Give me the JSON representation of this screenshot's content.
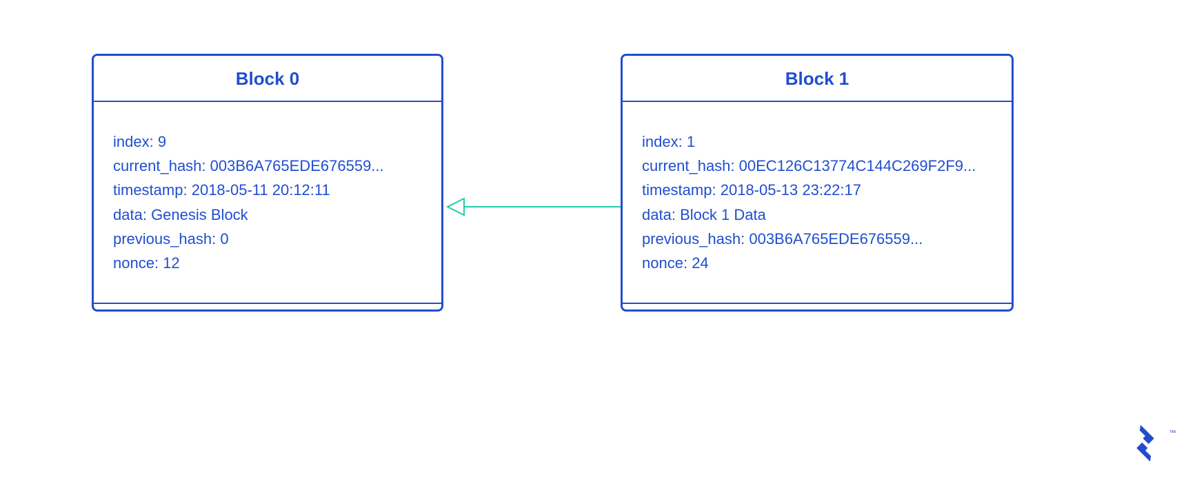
{
  "blocks": [
    {
      "title": "Block 0",
      "fields": [
        {
          "key": "index",
          "value": "9"
        },
        {
          "key": "current_hash",
          "value": "003B6A765EDE676559..."
        },
        {
          "key": "timestamp",
          "value": "2018-05-11 20:12:11"
        },
        {
          "key": "data",
          "value": "Genesis Block"
        },
        {
          "key": "previous_hash",
          "value": "0"
        },
        {
          "key": "nonce",
          "value": "12"
        }
      ]
    },
    {
      "title": "Block 1",
      "fields": [
        {
          "key": "index",
          "value": "1"
        },
        {
          "key": "current_hash",
          "value": "00EC126C13774C144C269F2F9..."
        },
        {
          "key": "timestamp",
          "value": "2018-05-13 23:22:17"
        },
        {
          "key": "data",
          "value": "Block 1 Data"
        },
        {
          "key": "previous_hash",
          "value": "003B6A765EDE676559..."
        },
        {
          "key": "nonce",
          "value": "24"
        }
      ]
    }
  ],
  "colors": {
    "primary": "#204ECF",
    "arrow": "#1FCFA7"
  },
  "branding": {
    "trademark": "™"
  }
}
